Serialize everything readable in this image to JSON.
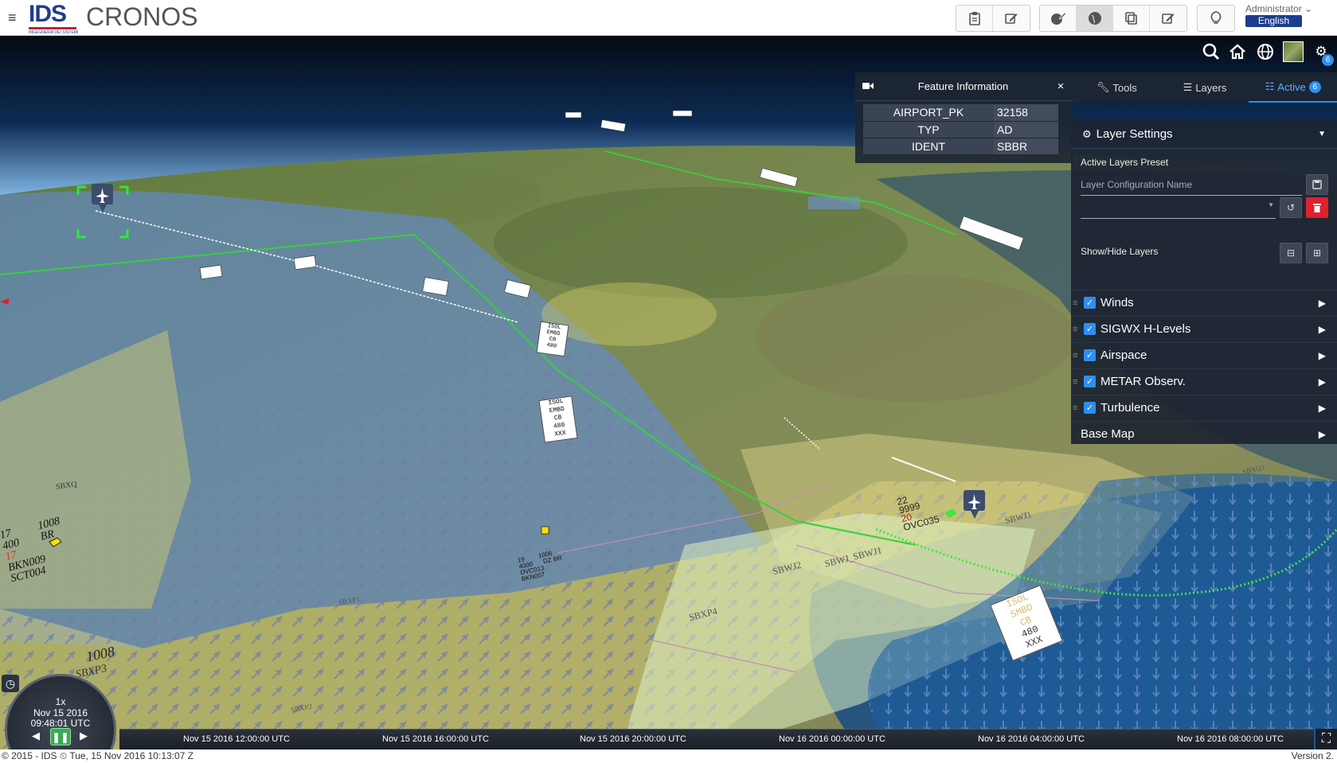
{
  "app": {
    "logo": "IDS",
    "logo_sub": "INGEGNERIA DEI SISTEMI",
    "title": "CRONOS"
  },
  "toolbar": {
    "group1": [
      "clipboard-icon",
      "edit-icon"
    ],
    "group2": [
      "globe-edit-icon",
      "globe-icon",
      "copy-icon",
      "edit-icon"
    ],
    "group3": [
      "lightbulb-icon"
    ],
    "active_button": "globe-icon"
  },
  "user": {
    "name": "Administrator",
    "language": "English"
  },
  "map_controls": {
    "active_count": "6"
  },
  "feature_info": {
    "title": "Feature Information",
    "close": "×",
    "rows": [
      {
        "key": "AIRPORT_PK",
        "value": "32158"
      },
      {
        "key": "TYP",
        "value": "AD"
      },
      {
        "key": "IDENT",
        "value": "SBBR"
      }
    ]
  },
  "tabs": [
    {
      "label": "Tools",
      "icon": "wrench-icon"
    },
    {
      "label": "Layers",
      "icon": "list-icon"
    },
    {
      "label": "Active",
      "icon": "sliders-icon",
      "badge": "6",
      "active": true
    }
  ],
  "layer_settings": {
    "title": "Layer Settings",
    "preset_label": "Active Layers Preset",
    "config_placeholder": "Layer Configuration Name",
    "show_hide_label": "Show/Hide Layers",
    "layers": [
      {
        "name": "Winds",
        "checked": true
      },
      {
        "name": "SIGWX H-Levels",
        "checked": true
      },
      {
        "name": "Airspace",
        "checked": true
      },
      {
        "name": "METAR Observ.",
        "checked": true
      },
      {
        "name": "Turbulence",
        "checked": true
      }
    ],
    "base_map": "Base Map"
  },
  "map_labels": {
    "sigwx_box_1": [
      "ISOL",
      "EMBD",
      "CB",
      "480",
      "XXX"
    ],
    "sigwx_box_2": [
      "ISOL",
      "SMBD",
      "CB",
      "480",
      "XXX"
    ],
    "metar_left": [
      "17",
      "1008",
      "400",
      "BR",
      "17",
      "BKN009",
      "SCT004"
    ],
    "metar_left_bottom": [
      "1008"
    ],
    "metar_mid": [
      "19",
      "1006",
      "4000",
      "DZ BR",
      "OVC013",
      "BKN007"
    ],
    "metar_right": [
      "22",
      "9999",
      "20",
      "OVC035"
    ],
    "fir_labels": [
      "SBXQ",
      "SBWJ2",
      "SBWJ_SBWJ1",
      "SBXP4",
      "SBWJ1",
      "SBXP3",
      "SBXP1",
      "SBXP2",
      "SBXQ1"
    ]
  },
  "clock": {
    "speed": "1x",
    "date": "Nov 15 2016",
    "time": "09:48:01 UTC"
  },
  "timeline": {
    "labels": [
      "Nov 15 2016 12:00:00 UTC",
      "Nov 15 2016 16:00:00 UTC",
      "Nov 15 2016 20:00:00 UTC",
      "Nov 16 2016 00:00:00 UTC",
      "Nov 16 2016 04:00:00 UTC",
      "Nov 16 2016 08:00:00 UTC"
    ]
  },
  "footer": {
    "left": "© 2015 - IDS ⏲ Tue, 15 Nov 2016 10:13:07 Z",
    "right": "Version 2."
  },
  "colors": {
    "accent": "#2d8ff0",
    "brand": "#1d3d8f",
    "danger": "#e0202f",
    "route": "#3ee83a"
  }
}
